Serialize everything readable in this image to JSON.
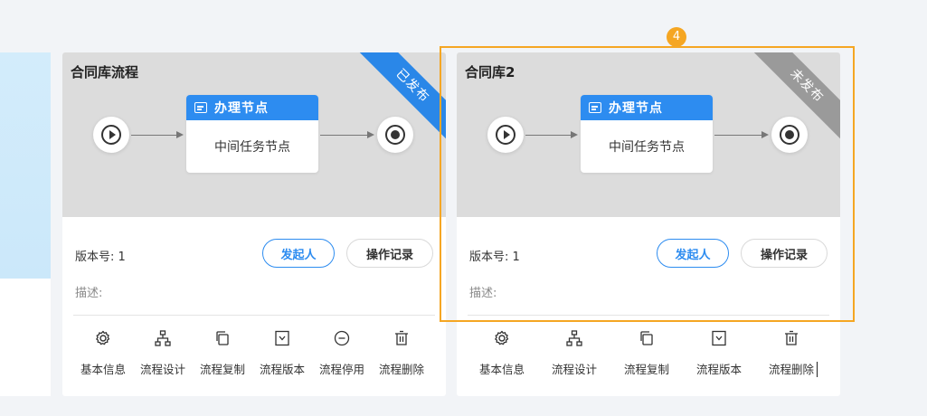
{
  "cards": [
    {
      "title": "合同库流程",
      "status_ribbon": "已发布",
      "task_node_title": "办理节点",
      "task_node_body": "中间任务节点",
      "version_label": "版本号: 1",
      "description_label": "描述:",
      "initiator_button": "发起人",
      "log_button": "操作记录",
      "actions": [
        {
          "label": "基本信息",
          "icon": "gear-icon"
        },
        {
          "label": "流程设计",
          "icon": "org-tree-icon"
        },
        {
          "label": "流程复制",
          "icon": "copy-icon"
        },
        {
          "label": "流程版本",
          "icon": "version-icon"
        },
        {
          "label": "流程停用",
          "icon": "minus-circle-icon"
        },
        {
          "label": "流程删除",
          "icon": "trash-icon"
        }
      ]
    },
    {
      "title": "合同库2",
      "status_ribbon": "未发布",
      "task_node_title": "办理节点",
      "task_node_body": "中间任务节点",
      "version_label": "版本号: 1",
      "description_label": "描述:",
      "initiator_button": "发起人",
      "log_button": "操作记录",
      "actions": [
        {
          "label": "基本信息",
          "icon": "gear-icon"
        },
        {
          "label": "流程设计",
          "icon": "org-tree-icon"
        },
        {
          "label": "流程复制",
          "icon": "copy-icon"
        },
        {
          "label": "流程版本",
          "icon": "version-icon"
        },
        {
          "label": "流程删除",
          "icon": "trash-icon"
        }
      ]
    }
  ],
  "step_badge": "4",
  "colors": {
    "primary": "#2d8cf0",
    "published_ribbon": "#2a87e8",
    "unpublished_ribbon": "#9a9a9a",
    "highlight": "#f5a623"
  }
}
